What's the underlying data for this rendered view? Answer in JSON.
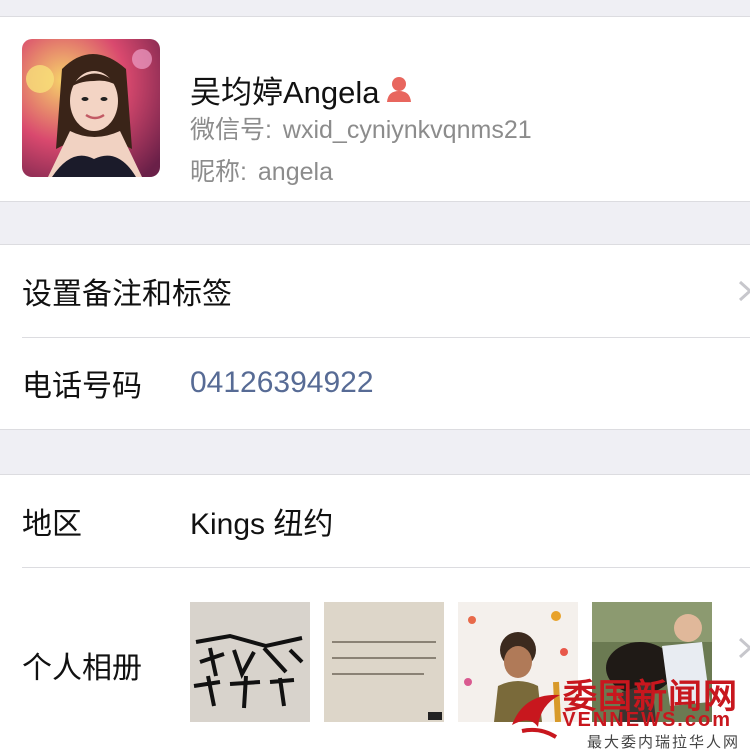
{
  "profile": {
    "name": "吴均婷Angela",
    "wechat_id_label": "微信号:",
    "wechat_id": "wxid_cyniynkvqnms21",
    "nickname_label": "昵称:",
    "nickname": "angela",
    "gender_icon": "female-icon",
    "gender_color": "#e8665e"
  },
  "section1": {
    "remark_label": "设置备注和标签",
    "phone_label": "电话号码",
    "phone_value": "04126394922"
  },
  "section2": {
    "region_label": "地区",
    "region_value": "Kings 纽约",
    "album_label": "个人相册"
  },
  "watermark": {
    "title": "委国新闻网",
    "site": "VENNEWS.com",
    "tagline": "最大委内瑞拉华人网"
  },
  "colors": {
    "link": "#576b95",
    "background": "#efeff4",
    "watermark": "#c8171e"
  }
}
